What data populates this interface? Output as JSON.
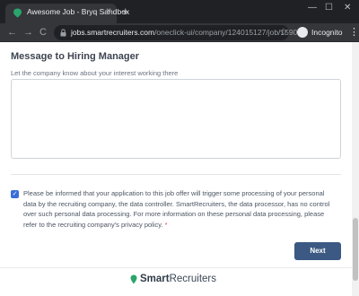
{
  "browser": {
    "tab_title": "Awesome Job - Bryq Sandbox",
    "tab_close": "×",
    "new_tab": "+",
    "win_min": "—",
    "win_max": "☐",
    "win_close": "✕",
    "back": "←",
    "forward": "→",
    "reload": "C",
    "url_host": "jobs.smartrecruiters.com",
    "url_path": "/oneclick-ui/company/124015127/job/15907...",
    "star": "☆",
    "incognito_label": "Incognito",
    "menu": "⋮",
    "favicon_color": "#2aa56b"
  },
  "form": {
    "section_title": "Message to Hiring Manager",
    "section_subtitle": "Let the company know about your interest working there",
    "message_value": "",
    "consent_checked": true,
    "consent_text": "Please be informed that your application to this job offer will trigger some processing of your personal data by the recruiting company, the data controller. SmartRecruiters, the data processor, has no control over such personal data processing. For more information on these personal data processing, please refer to the recruiting company's privacy policy.",
    "required_mark": "*",
    "next_label": "Next"
  },
  "footer": {
    "brand_part1": "Smart",
    "brand_part2": "Recruiters",
    "logo_color": "#2aa56b"
  },
  "colors": {
    "accent_button": "#3b5983",
    "checkbox": "#3b6ed8",
    "required": "#e04e4e"
  }
}
